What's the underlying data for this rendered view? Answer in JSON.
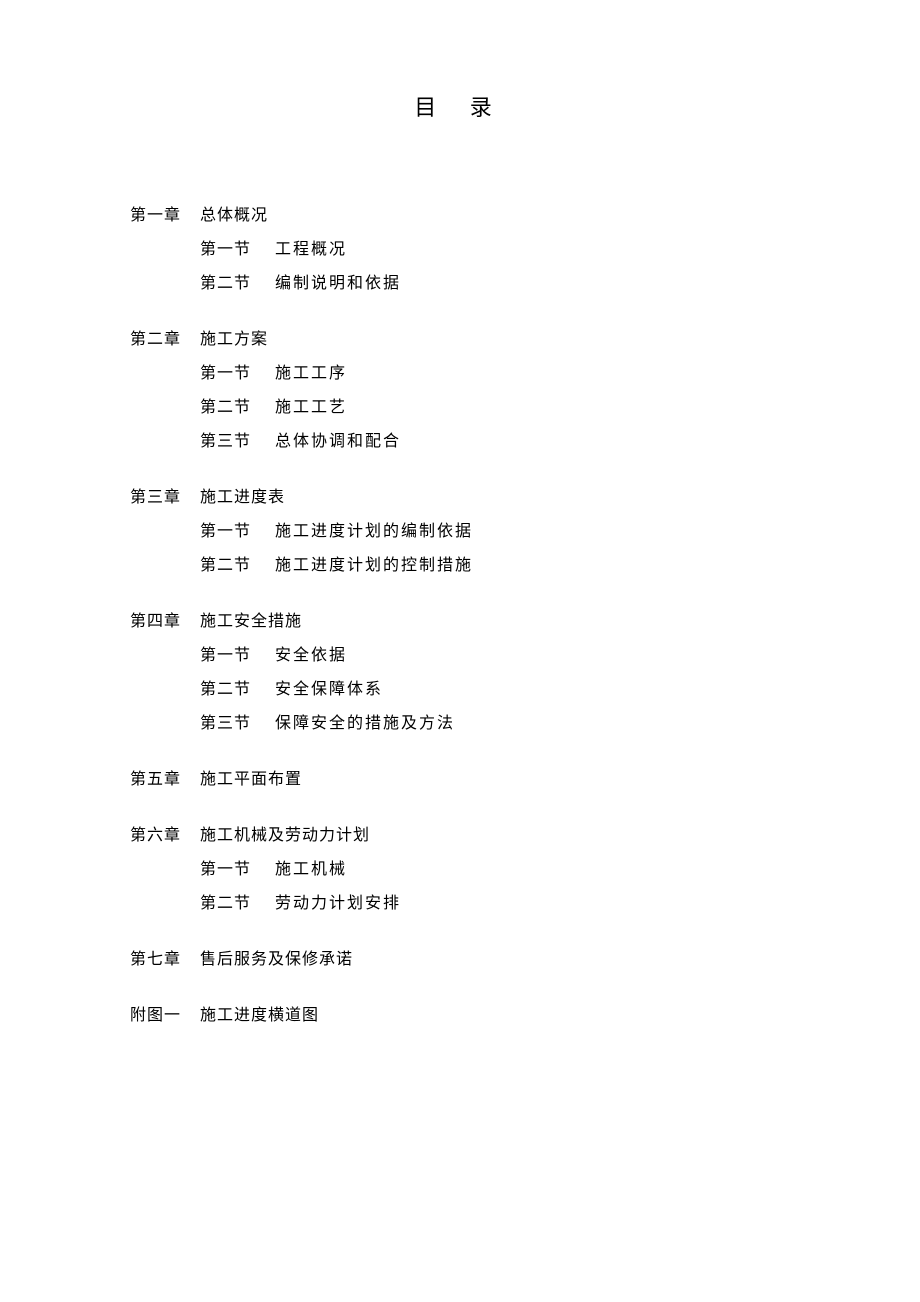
{
  "title": "目 录",
  "chapters": [
    {
      "name": "第一章",
      "title": "总体概况",
      "sections": [
        {
          "name": "第一节",
          "title": "工程概况"
        },
        {
          "name": "第二节",
          "title": "编制说明和依据"
        }
      ]
    },
    {
      "name": "第二章",
      "title": "施工方案",
      "sections": [
        {
          "name": "第一节",
          "title": "施工工序"
        },
        {
          "name": "第二节",
          "title": "施工工艺"
        },
        {
          "name": "第三节",
          "title": "总体协调和配合"
        }
      ]
    },
    {
      "name": "第三章",
      "title": "施工进度表",
      "sections": [
        {
          "name": "第一节",
          "title": "施工进度计划的编制依据"
        },
        {
          "name": "第二节",
          "title": "施工进度计划的控制措施"
        }
      ]
    },
    {
      "name": "第四章",
      "title": "施工安全措施",
      "sections": [
        {
          "name": "第一节",
          "title": "安全依据"
        },
        {
          "name": "第二节",
          "title": "安全保障体系"
        },
        {
          "name": "第三节",
          "title": "保障安全的措施及方法"
        }
      ]
    },
    {
      "name": "第五章",
      "title": "施工平面布置",
      "sections": []
    },
    {
      "name": "第六章",
      "title": "施工机械及劳动力计划",
      "sections": [
        {
          "name": "第一节",
          "title": "施工机械"
        },
        {
          "name": "第二节",
          "title": "劳动力计划安排"
        }
      ]
    },
    {
      "name": "第七章",
      "title": "售后服务及保修承诺",
      "sections": []
    },
    {
      "name": "附图一",
      "title": "施工进度横道图",
      "sections": []
    }
  ]
}
